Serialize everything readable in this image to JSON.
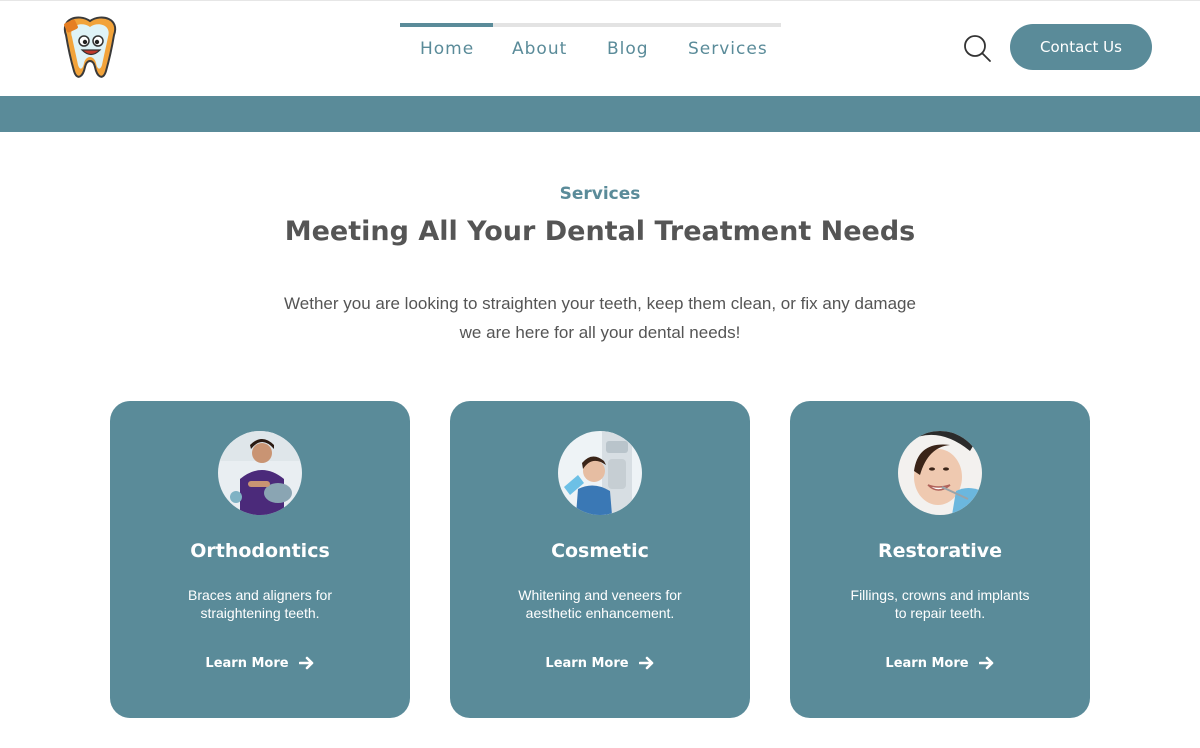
{
  "header": {
    "logo_icon": "cartoon-tooth-logo",
    "nav": [
      {
        "label": "Home",
        "active": true
      },
      {
        "label": "About",
        "active": false
      },
      {
        "label": "Blog",
        "active": false
      },
      {
        "label": "Services",
        "active": false
      }
    ],
    "search_icon": "search-icon",
    "contact_label": "Contact Us"
  },
  "section": {
    "eyebrow": "Services",
    "title": "Meeting All Your Dental Treatment Needs",
    "description_line1": "Wether you are looking to straighten your teeth, keep them clean, or fix any damage",
    "description_line2": "we are here for all your dental needs!"
  },
  "cards": [
    {
      "title": "Orthodontics",
      "text_line1": "Braces and aligners for",
      "text_line2": "straightening teeth.",
      "link": "Learn More",
      "image": "dentist-with-patient-photo"
    },
    {
      "title": "Cosmetic",
      "text_line1": "Whitening and veneers for",
      "text_line2": "aesthetic enhancement.",
      "link": "Learn More",
      "image": "patient-dental-xray-photo"
    },
    {
      "title": "Restorative",
      "text_line1": "Fillings, crowns and implants",
      "text_line2": "to repair teeth.",
      "link": "Learn More",
      "image": "patient-smiling-checkup-photo"
    }
  ],
  "colors": {
    "primary": "#5a8b99",
    "heading": "#555555",
    "background": "#ffffff"
  }
}
